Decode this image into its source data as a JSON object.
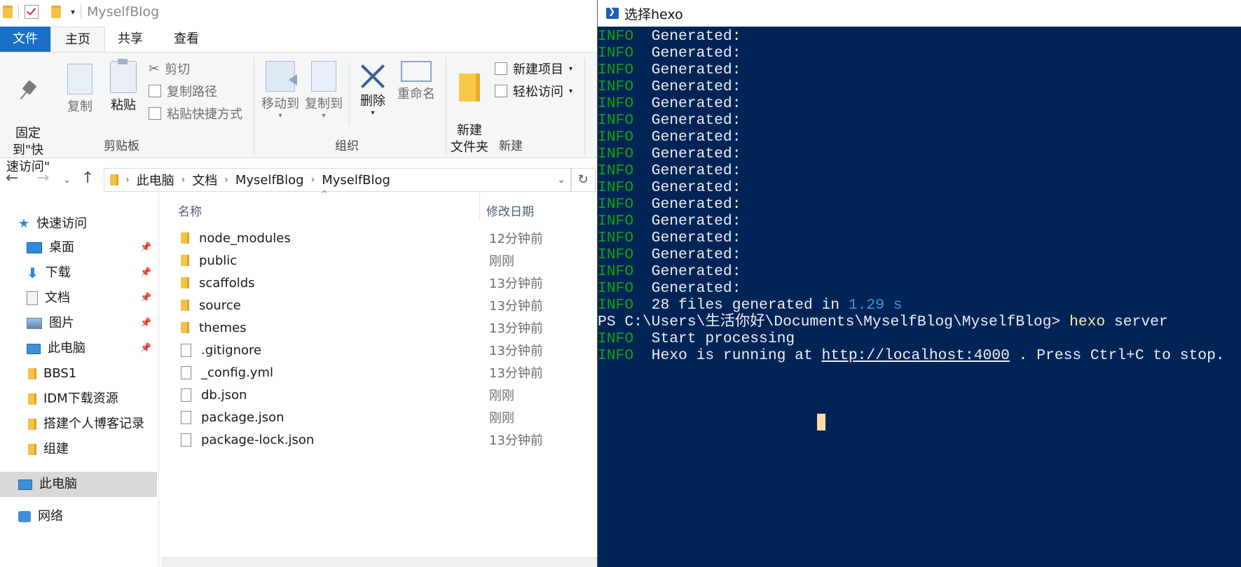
{
  "explorer": {
    "title": "MyselfBlog",
    "ribbon_tabs": [
      "文件",
      "主页",
      "共享",
      "查看"
    ],
    "clipboard": {
      "pin_label": "固定到\"快\n速访问\"",
      "copy_label": "复制",
      "paste_label": "粘贴",
      "cut_label": "剪切",
      "copy_path_label": "复制路径",
      "paste_shortcut_label": "粘贴快捷方式",
      "group_label": "剪贴板"
    },
    "organize": {
      "move_to_label": "移动到",
      "copy_to_label": "复制到",
      "delete_label": "删除",
      "rename_label": "重命名",
      "group_label": "组织"
    },
    "new": {
      "new_folder_label": "新建\n文件夹",
      "new_item_label": "新建项目",
      "easy_access_label": "轻松访问",
      "group_label": "新建"
    },
    "address": {
      "crumbs": [
        "此电脑",
        "文档",
        "MyselfBlog",
        "MyselfBlog"
      ]
    },
    "nav_pane": {
      "quick_access": "快速访问",
      "items": [
        {
          "label": "桌面",
          "icon": "desktop-icon",
          "pinned": true
        },
        {
          "label": "下载",
          "icon": "download-icon",
          "pinned": true
        },
        {
          "label": "文档",
          "icon": "documents-icon",
          "pinned": true
        },
        {
          "label": "图片",
          "icon": "pictures-icon",
          "pinned": true
        },
        {
          "label": "此电脑",
          "icon": "computer-icon",
          "pinned": true
        },
        {
          "label": "BBS1",
          "icon": "folder-icon",
          "pinned": false
        },
        {
          "label": "IDM下载资源",
          "icon": "folder-icon",
          "pinned": false
        },
        {
          "label": "搭建个人博客记录",
          "icon": "folder-icon",
          "pinned": false
        },
        {
          "label": "组建",
          "icon": "folder-icon",
          "pinned": false
        }
      ],
      "this_pc": "此电脑",
      "network": "网络"
    },
    "columns": {
      "name": "名称",
      "date": "修改日期"
    },
    "files": [
      {
        "name": "node_modules",
        "type": "folder",
        "date": "12分钟前"
      },
      {
        "name": "public",
        "type": "folder",
        "date": "刚刚"
      },
      {
        "name": "scaffolds",
        "type": "folder",
        "date": "13分钟前"
      },
      {
        "name": "source",
        "type": "folder",
        "date": "13分钟前"
      },
      {
        "name": "themes",
        "type": "folder",
        "date": "13分钟前"
      },
      {
        "name": ".gitignore",
        "type": "file",
        "date": "13分钟前"
      },
      {
        "name": "_config.yml",
        "type": "file",
        "date": "13分钟前"
      },
      {
        "name": "db.json",
        "type": "file",
        "date": "刚刚"
      },
      {
        "name": "package.json",
        "type": "file",
        "date": "刚刚"
      },
      {
        "name": "package-lock.json",
        "type": "file",
        "date": "13分钟前"
      }
    ]
  },
  "powershell": {
    "title": "选择hexo",
    "info_tag": "INFO",
    "generated_text": "Generated:",
    "generated_count_lines": 16,
    "summary_pre": "28 files generated in ",
    "summary_time": "1.29 s",
    "prompt": "PS C:\\Users\\生活你好\\Documents\\MyselfBlog\\MyselfBlog> ",
    "command": "hexo",
    "command_args": " server",
    "start_text": "Start processing",
    "running_pre": "Hexo is running at ",
    "running_url": "http://localhost:4000",
    "running_post": " . Press Ctrl+C to stop.",
    "colors": {
      "background": "#012456",
      "info": "#13a10e",
      "number": "#3a96dd",
      "command": "#f9f1a5",
      "cursor": "#fedba9"
    }
  }
}
